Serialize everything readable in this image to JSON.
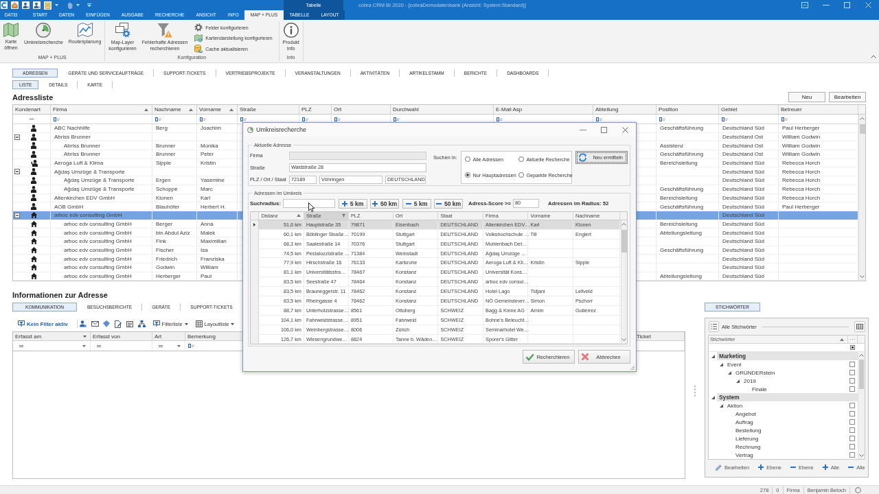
{
  "title_bar": {
    "context_label": "Tabelle",
    "title": "cobra CRM BI 2020 - [cobraDemodatenbank (Ansicht: System:Standard)]"
  },
  "ribbon": {
    "tabs": [
      {
        "label": "DATEI",
        "selected": false,
        "contextual": false
      },
      {
        "label": "START",
        "selected": false,
        "contextual": false
      },
      {
        "label": "DATEN",
        "selected": false,
        "contextual": false
      },
      {
        "label": "EINFÜGEN",
        "selected": false,
        "contextual": false
      },
      {
        "label": "AUSGABE",
        "selected": false,
        "contextual": false
      },
      {
        "label": "RECHERCHE",
        "selected": false,
        "contextual": false
      },
      {
        "label": "ANSICHT",
        "selected": false,
        "contextual": false
      },
      {
        "label": "INFO",
        "selected": false,
        "contextual": false
      },
      {
        "label": "MAP + PLUS",
        "selected": true,
        "contextual": false
      },
      {
        "label": "TABELLE",
        "selected": false,
        "contextual": true
      },
      {
        "label": "LAYOUT",
        "selected": false,
        "contextual": true
      }
    ],
    "groups": [
      {
        "label": "MAP + PLUS",
        "items": [
          {
            "label": "Karte\nöffnen",
            "kind": "map"
          },
          {
            "label": "Umkreisrecherche",
            "kind": "radius"
          },
          {
            "label": "Routenplanung",
            "kind": "route"
          }
        ]
      },
      {
        "label": "Konfiguration",
        "items": [
          {
            "label": "Map-Layer\nkonfigurieren",
            "kind": "layers"
          },
          {
            "label": "Fehlerhafte Adressen\nrecherchieren",
            "kind": "faulty"
          }
        ],
        "small_items": [
          {
            "label": "Felder konfigurieren",
            "kind": "fields"
          },
          {
            "label": "Kartendarstellung konfigurieren",
            "kind": "map_style"
          },
          {
            "label": "Cache aktualisieren",
            "kind": "cache"
          }
        ]
      },
      {
        "label": "Info",
        "items": [
          {
            "label": "Produkt\nInfo",
            "kind": "info"
          }
        ]
      }
    ]
  },
  "main_tabs": [
    {
      "label": "ADRESSEN",
      "selected": true
    },
    {
      "label": "GERÄTE UND SERVICEAUFTRÄGE",
      "selected": false
    },
    {
      "label": "SUPPORT-TICKETS",
      "selected": false
    },
    {
      "label": "VERTRIEBSPROJEKTE",
      "selected": false
    },
    {
      "label": "VERANSTALTUNGEN",
      "selected": false
    },
    {
      "label": "AKTIVITÄTEN",
      "selected": false
    },
    {
      "label": "ARTIKELSTAMM",
      "selected": false
    },
    {
      "label": "BERICHTE",
      "selected": false
    },
    {
      "label": "DASHBOARDS",
      "selected": false
    }
  ],
  "sub_tabs": [
    {
      "label": "LISTE",
      "selected": true
    },
    {
      "label": "DETAILS",
      "selected": false
    },
    {
      "label": "KARTE",
      "selected": false
    }
  ],
  "address_list": {
    "title": "Adressliste",
    "buttons": [
      "Neu",
      "Bearbeiten"
    ],
    "columns": [
      {
        "label": "Kundenart",
        "sorted": false,
        "text_filter": false
      },
      {
        "label": "Firma",
        "sorted": true,
        "text_filter": true
      },
      {
        "label": "Nachname",
        "sorted": true,
        "text_filter": true
      },
      {
        "label": "Vorname",
        "sorted": true,
        "text_filter": true
      },
      {
        "label": "Straße",
        "sorted": false,
        "text_filter": true
      },
      {
        "label": "PLZ",
        "sorted": false,
        "text_filter": true
      },
      {
        "label": "Ort",
        "sorted": false,
        "text_filter": true
      },
      {
        "label": "Durchwahl",
        "sorted": false,
        "text_filter": true
      },
      {
        "label": "E-Mail Asp",
        "sorted": false,
        "text_filter": true
      },
      {
        "label": "Abteilung",
        "sorted": false,
        "text_filter": true
      },
      {
        "label": "Position",
        "sorted": false,
        "text_filter": true
      },
      {
        "label": "Gebiet",
        "sorted": false,
        "text_filter": true
      },
      {
        "label": "Betreuer",
        "sorted": false,
        "text_filter": true
      }
    ],
    "rows": [
      {
        "kind": "person",
        "firma": "ABC Nachhilfe",
        "nachname": "Berg",
        "vorname": "Joachim",
        "position": "Geschäftsführung",
        "gebiet": "Deutschland Süd",
        "betreuer": "Paul Herberger",
        "selected": false
      },
      {
        "kind": "person",
        "firma": "Abriss Brunner",
        "gebiet": "Deutschland Ost",
        "betreuer": "William Godwin",
        "selected": false,
        "expanded": true,
        "children": [
          {
            "kind": "person",
            "firma": "Abriss Brunner",
            "nachname": "Brunner",
            "vorname": "Monika",
            "position": "Assistenz",
            "gebiet": "Deutschland Ost",
            "betreuer": "William Godwin",
            "selected": false
          },
          {
            "kind": "person",
            "firma": "Abriss Brunner",
            "nachname": "Brunner",
            "vorname": "Peter",
            "position": "Geschäftsführung",
            "gebiet": "Deutschland Ost",
            "betreuer": "William Godwin",
            "selected": false
          }
        ]
      },
      {
        "kind": "contact",
        "firma": "Aeroga Luft & Klima",
        "nachname": "Sipple",
        "vorname": "Kristin",
        "position": "Bereichsleitung",
        "gebiet": "Deutschland Süd",
        "betreuer": "Rebecca Horch",
        "selected": false
      },
      {
        "kind": "person",
        "firma": "Ağdaş Umzüge & Transporte",
        "gebiet": "Deutschland Süd",
        "betreuer": "Rebecca Horch",
        "selected": false,
        "expanded": true,
        "children": [
          {
            "kind": "person",
            "firma": "Ağdaş Umzüge & Transporte",
            "nachname": "Ergen",
            "vorname": "Yasemine",
            "gebiet": "Deutschland Süd",
            "betreuer": "Rebecca Horch",
            "selected": false
          },
          {
            "kind": "person",
            "firma": "Ağdaş Umzüge & Transporte",
            "nachname": "Schoppe",
            "vorname": "Marc",
            "position": "Geschäftsführung",
            "gebiet": "Deutschland Süd",
            "betreuer": "Rebecca Horch",
            "selected": false
          }
        ]
      },
      {
        "kind": "person",
        "firma": "Altenkirchen EDV GmbH",
        "nachname": "Klonen",
        "vorname": "Karl",
        "position": "Bereichsleitung",
        "gebiet": "Deutschland Süd",
        "betreuer": "Rebecca Horch",
        "selected": false
      },
      {
        "kind": "person",
        "firma": "AOB GmbH",
        "nachname": "Blauhöfer",
        "vorname": "Herbert H.",
        "position": "Geschäftsführung",
        "gebiet": "Deutschland Süd",
        "betreuer": "Paul Herberger",
        "selected": false
      },
      {
        "kind": "house",
        "firma": "arboc edv consulting GmbH",
        "gebiet": "Deutschland Süd",
        "selected": true,
        "expanded": true,
        "children": [
          {
            "kind": "house",
            "firma": "arboc edv consulting GmbH",
            "nachname": "Berger",
            "vorname": "Anna",
            "position": "Bereichsleitung",
            "gebiet": "Deutschland Süd",
            "selected": false
          },
          {
            "kind": "house",
            "firma": "arboc edv consulting GmbH",
            "nachname": "bin Abdul Aziz",
            "vorname": "Malek",
            "position": "Abteilungsleitung",
            "gebiet": "Deutschland Süd",
            "selected": false
          },
          {
            "kind": "house",
            "firma": "arboc edv consulting GmbH",
            "nachname": "Fink",
            "vorname": "Maximilian",
            "gebiet": "Deutschland Süd",
            "selected": false
          },
          {
            "kind": "house",
            "firma": "arboc edv consulting GmbH",
            "nachname": "Fischer",
            "vorname": "Isa",
            "position": "Geschäftsführung",
            "gebiet": "Deutschland Süd",
            "selected": false
          },
          {
            "kind": "house",
            "firma": "arboc edv consulting GmbH",
            "nachname": "Friedrich",
            "vorname": "Franziska",
            "gebiet": "Deutschland Süd",
            "selected": false
          },
          {
            "kind": "house",
            "firma": "arboc edv consulting GmbH",
            "nachname": "Godwin",
            "vorname": "William",
            "gebiet": "Deutschland Süd",
            "selected": false
          },
          {
            "kind": "house",
            "firma": "arboc edv consulting GmbH",
            "nachname": "Herberger",
            "vorname": "Paul",
            "position": "Abteilungsleitung",
            "gebiet": "Deutschland Süd",
            "selected": false
          }
        ]
      }
    ]
  },
  "address_info": {
    "title": "Informationen zur Adresse",
    "tabs": [
      {
        "label": "KOMMUNIKATION",
        "selected": true
      },
      {
        "label": "BESUCHSBERICHTE",
        "selected": false
      },
      {
        "label": "GERÄTE",
        "selected": false
      },
      {
        "label": "SUPPORT-TICKETS",
        "selected": false
      }
    ],
    "toolbar": {
      "filter_status": "Kein Filter aktiv",
      "filter_list": "Filterliste",
      "layout_list": "Layoutliste"
    },
    "columns": [
      {
        "label": "Erfasst am",
        "dropdown": true,
        "equals_filter": true,
        "filter_dropdown": true,
        "text_filter": false
      },
      {
        "label": "Erfasst von",
        "dropdown": false,
        "equals_filter": true,
        "filter_dropdown": false,
        "text_filter": false
      },
      {
        "label": "Art",
        "dropdown": false,
        "equals_filter": true,
        "filter_dropdown": true,
        "text_filter": false
      },
      {
        "label": "Bemerkung",
        "dropdown": false,
        "equals_filter": false,
        "filter_dropdown": false,
        "text_filter": true
      },
      {
        "label": "Ticket",
        "dropdown": false,
        "equals_filter": false,
        "filter_dropdown": false,
        "text_filter": false
      }
    ]
  },
  "keywords": {
    "tabs": [
      {
        "label": "STICHWÖRTER",
        "selected": true
      }
    ],
    "scope": "Alle Stichwörter",
    "column": {
      "label": "Stichwörter",
      "sorted": true
    },
    "tree": [
      {
        "label": "Marketing",
        "expanded": true,
        "children": [
          {
            "label": "Event",
            "checked": false,
            "expanded": true,
            "children": [
              {
                "label": "GRÜNDERstein",
                "checked": false,
                "expanded": true,
                "children": [
                  {
                    "label": "2019",
                    "checked": false,
                    "expanded": true,
                    "children": [
                      {
                        "label": "Finale",
                        "checked": false
                      }
                    ]
                  }
                ]
              }
            ]
          }
        ]
      },
      {
        "label": "System",
        "expanded": true,
        "children": [
          {
            "label": "Aktion",
            "checked": false,
            "expanded": true,
            "children": [
              {
                "label": "Angebot",
                "checked": false
              },
              {
                "label": "Auftrag",
                "checked": false
              },
              {
                "label": "Bestellung",
                "checked": false
              },
              {
                "label": "Lieferung",
                "checked": false
              },
              {
                "label": "Rechnung",
                "checked": false
              },
              {
                "label": "Vertrag",
                "checked": false
              }
            ]
          }
        ]
      }
    ],
    "actions": [
      {
        "label": "Bearbeiten",
        "kind": "edit"
      },
      {
        "label": "Ebene",
        "kind": "plus"
      },
      {
        "label": "Ebene",
        "kind": "minus"
      },
      {
        "label": "Alle",
        "kind": "plus"
      },
      {
        "label": "Alle",
        "kind": "minus"
      }
    ]
  },
  "status_bar": {
    "items": [
      "278",
      "0",
      "Firma",
      "Benjamin Beloch"
    ]
  },
  "dialog": {
    "title": "Umkreisrecherche",
    "current_address": {
      "legend": "Aktuelle Adresse",
      "fields": [
        {
          "label": "Firma",
          "disabled": true
        },
        {
          "label": "Straße",
          "value": "Waldstraße 28",
          "disabled": false
        },
        {
          "label": "PLZ / Ort / Staat",
          "values": [
            "72189",
            "Vöhringen",
            "DEUTSCHLAND"
          ],
          "disabled": false
        }
      ],
      "search_in_label": "Suchen in:",
      "search_in": [
        {
          "label": "Alle Adressen",
          "selected": false
        },
        {
          "label": "Aktuelle Recherche",
          "selected": false
        },
        {
          "label": "Nur Hauptadressen",
          "selected": true
        },
        {
          "label": "Geparkte Recherche",
          "selected": false
        }
      ],
      "refresh_button": "Neu ermitteln"
    },
    "surroundings": {
      "legend": "Adressen im Umkreis",
      "radius_label": "Suchradius:",
      "steps": [
        {
          "label": "5 km",
          "kind": "plus"
        },
        {
          "label": "50 km",
          "kind": "plus"
        },
        {
          "label": "5 km",
          "kind": "minus"
        },
        {
          "label": "50 km",
          "kind": "minus"
        }
      ],
      "score_label": "Adress-Score >=",
      "score_value": "80",
      "count": "Adressen im Radius: 52"
    },
    "table": {
      "columns": [
        {
          "label": "Distanz",
          "sorted": true,
          "hovered": false
        },
        {
          "label": "Straße",
          "sorted": false,
          "hovered": true
        },
        {
          "label": "PLZ",
          "sorted": false,
          "hovered": false
        },
        {
          "label": "Ort",
          "sorted": false,
          "hovered": false
        },
        {
          "label": "Staat",
          "sorted": false,
          "hovered": false
        },
        {
          "label": "Firma",
          "sorted": false,
          "hovered": false
        },
        {
          "label": "Vorname",
          "sorted": false,
          "hovered": false
        },
        {
          "label": "Nachname",
          "sorted": false,
          "hovered": false
        }
      ],
      "rows": [
        {
          "distanz": "51,6 km",
          "strasse": "Hauptstraße 35",
          "plz": "79871",
          "ort": "Eisenbach",
          "staat": "DEUTSCHLAND",
          "firma": "Altenkirchen EDV…",
          "vorname": "Karl",
          "nachname": "Klonen",
          "selected": true
        },
        {
          "distanz": "60,1 km",
          "strasse": "Böblinger Straße…",
          "plz": "70199",
          "ort": "Stuttgart",
          "staat": "DEUTSCHLAND",
          "firma": "Volkshochschule …",
          "vorname": "Till",
          "nachname": "Englert",
          "selected": false
        },
        {
          "distanz": "68,3 km",
          "strasse": "Saalestraße 14",
          "plz": "70376",
          "ort": "Stuttgart",
          "staat": "DEUTSCHLAND",
          "firma": "Muhlenbach Det…",
          "selected": false
        },
        {
          "distanz": "74,5 km",
          "strasse": "Pestalozzistraße …",
          "plz": "71384",
          "ort": "Weinstadt",
          "staat": "DEUTSCHLAND",
          "firma": "Ağdaş Umzüge …",
          "selected": false
        },
        {
          "distanz": "77,9 km",
          "strasse": "Hirschstraße 16",
          "plz": "76133",
          "ort": "Karlsruhe",
          "staat": "DEUTSCHLAND",
          "firma": "Aeroga Luft & Kli…",
          "vorname": "Kristin",
          "nachname": "Sipple",
          "selected": false
        },
        {
          "distanz": "81,1 km",
          "strasse": "Universitätsstra…",
          "plz": "78467",
          "ort": "Konstanz",
          "staat": "DEUTSCHLAND",
          "firma": "Universität Kons…",
          "selected": false
        },
        {
          "distanz": "83,5 km",
          "strasse": "Seestraße 47",
          "plz": "78464",
          "ort": "Konstanz",
          "staat": "DEUTSCHLAND",
          "firma": "arboc edv consul…",
          "selected": false
        },
        {
          "distanz": "83,5 km",
          "strasse": "Brauneggerstr. 11",
          "plz": "78462",
          "ort": "Konstanz",
          "staat": "DEUTSCHLAND",
          "firma": "Hotel Lago",
          "vorname": "Tidjani",
          "nachname": "Leliveld",
          "selected": false
        },
        {
          "distanz": "83,5 km",
          "strasse": "Rheingasse 4",
          "plz": "78462",
          "ort": "Konstanz",
          "staat": "DEUTSCHLAND",
          "firma": "NÖ Gemeindever…",
          "vorname": "Simon",
          "nachname": "Pschorr",
          "selected": false
        },
        {
          "distanz": "88,7 km",
          "strasse": "Unterholzstrasse…",
          "plz": "8561",
          "ort": "Ottoberg",
          "staat": "SCHWEIZ",
          "firma": "Bagg & Kinne AG",
          "vorname": "Arnim",
          "nachname": "Gutiérrez",
          "selected": false
        },
        {
          "distanz": "104,1 km",
          "strasse": "Fahrweidstrasse…",
          "plz": "8951",
          "ort": "Fahrweid",
          "staat": "SCHWEIZ",
          "firma": "Bohne's Beleucht…",
          "selected": false
        },
        {
          "distanz": "106,0 km",
          "strasse": "Weinbergstrasse…",
          "plz": "8006",
          "ort": "Zürich",
          "staat": "SCHWEIZ",
          "firma": "Seminarhotel We…",
          "selected": false
        },
        {
          "distanz": "126,7 km",
          "strasse": "Wiesengrundwe…",
          "plz": "8824",
          "ort": "Tanne b. Wäden…",
          "staat": "SCHWEIZ",
          "firma": "Sporer's Gitter",
          "selected": false
        }
      ]
    },
    "buttons": [
      {
        "label": "Recherchieren",
        "kind": "confirm"
      },
      {
        "label": "Abbrechen",
        "kind": "cancel"
      }
    ]
  }
}
